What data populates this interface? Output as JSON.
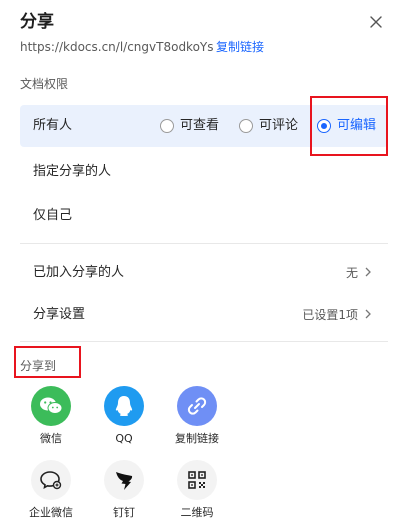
{
  "dialog": {
    "title": "分享",
    "url": "https://kdocs.cn/l/cngvT8odkoYs",
    "copy_link_label": "复制链接"
  },
  "permissions": {
    "section_label": "文档权限",
    "everyone_label": "所有人",
    "options": [
      "可查看",
      "可评论",
      "可编辑"
    ],
    "selected": "可编辑",
    "specific_people_label": "指定分享的人",
    "only_me_label": "仅自己"
  },
  "settings": {
    "joined_label": "已加入分享的人",
    "joined_value": "无",
    "share_settings_label": "分享设置",
    "share_settings_value": "已设置1项"
  },
  "share_to": {
    "label": "分享到",
    "apps": [
      {
        "name": "微信",
        "icon": "wechat-icon",
        "color": "#3cbc5a"
      },
      {
        "name": "QQ",
        "icon": "qq-icon",
        "color": "#1f9bf0"
      },
      {
        "name": "复制链接",
        "icon": "link-icon",
        "color": "#6f8ff5"
      },
      {
        "name": "企业微信",
        "icon": "wecom-icon",
        "color": "#f3f3f3"
      },
      {
        "name": "钉钉",
        "icon": "dingtalk-icon",
        "color": "#f3f3f3"
      },
      {
        "name": "二维码",
        "icon": "qrcode-icon",
        "color": "#f3f3f3"
      }
    ]
  },
  "colors": {
    "accent": "#1a66ff",
    "highlight": "#e8141e",
    "selected_row_bg": "#eaf1fd"
  }
}
